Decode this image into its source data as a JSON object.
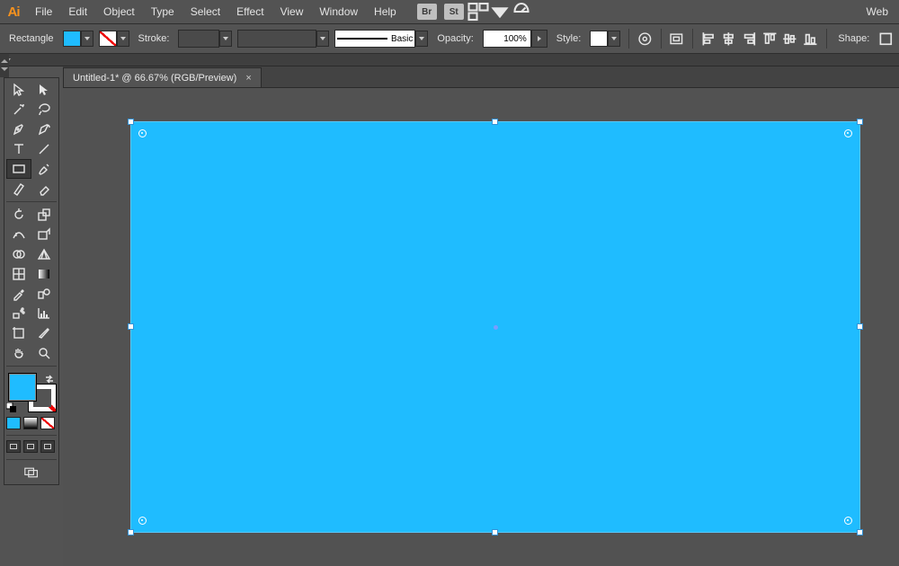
{
  "app": {
    "logo": "Ai",
    "workspace": "Web"
  },
  "menu": {
    "items": [
      "File",
      "Edit",
      "Object",
      "Type",
      "Select",
      "Effect",
      "View",
      "Window",
      "Help"
    ],
    "bridge_btn": "Br",
    "stock_btn": "St"
  },
  "optbar": {
    "shape_label": "Rectangle",
    "fill_color": "#1fbcff",
    "stroke_label": "Stroke:",
    "brush_label": "Basic",
    "opacity_label": "Opacity:",
    "opacity_value": "100%",
    "style_label": "Style:",
    "shape_panel_label": "Shape:"
  },
  "document": {
    "tab_title": "Untitled-1* @ 66.67% (RGB/Preview)"
  },
  "shape": {
    "fill": "#1fbcff"
  }
}
